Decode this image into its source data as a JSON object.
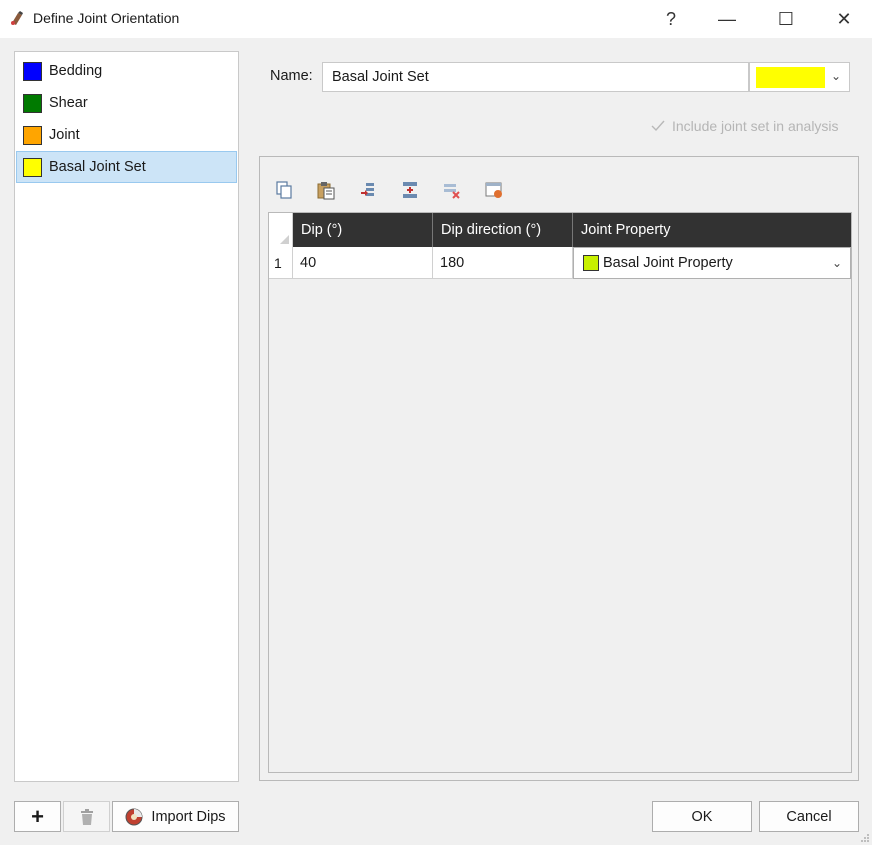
{
  "window": {
    "title": "Define Joint Orientation",
    "help": "?",
    "minimize": "—",
    "maximize": "☐",
    "close": "✕"
  },
  "joint_sets": [
    {
      "label": "Bedding",
      "color": "#0000ff"
    },
    {
      "label": "Shear",
      "color": "#007a00"
    },
    {
      "label": "Joint",
      "color": "#ffa500"
    },
    {
      "label": "Basal Joint Set",
      "color": "#ffff00",
      "selected": true
    }
  ],
  "form": {
    "name_label": "Name:",
    "name_value": "Basal Joint Set",
    "color_value": "#ffff00",
    "include_label": "Include joint set in analysis",
    "include_checked": true,
    "include_enabled": false
  },
  "toolbar": {
    "icons": [
      "copy-icon",
      "paste-icon",
      "insert-row-icon",
      "add-row-icon",
      "delete-row-icon",
      "properties-icon"
    ]
  },
  "table": {
    "columns": [
      "Dip (°)",
      "Dip direction (°)",
      "Joint Property"
    ],
    "rows": [
      {
        "index": "1",
        "dip": "40",
        "dip_direction": "180",
        "joint_property": "Basal Joint Property",
        "property_color": "#c8f000"
      }
    ]
  },
  "buttons": {
    "add": "+",
    "delete": "🗑",
    "import_dips": "Import Dips",
    "ok": "OK",
    "cancel": "Cancel"
  }
}
